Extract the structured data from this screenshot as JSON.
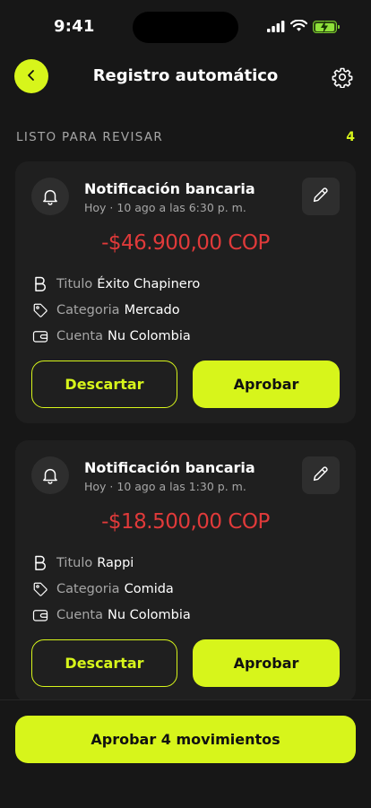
{
  "status_bar": {
    "time": "9:41"
  },
  "header": {
    "title": "Registro automático"
  },
  "section": {
    "label": "LISTO PARA REVISAR",
    "count": "4"
  },
  "labels": {
    "titulo": "Titulo",
    "categoria": "Categoria",
    "cuenta": "Cuenta"
  },
  "actions": {
    "discard": "Descartar",
    "approve": "Aprobar"
  },
  "cards": [
    {
      "title": "Notificación bancaria",
      "subtitle": "Hoy · 10 ago a las 6:30 p. m.",
      "amount": "-$46.900,00 COP",
      "titulo": "Éxito Chapinero",
      "categoria": "Mercado",
      "cuenta": "Nu Colombia"
    },
    {
      "title": "Notificación bancaria",
      "subtitle": "Hoy · 10 ago a las 1:30 p. m.",
      "amount": "-$18.500,00 COP",
      "titulo": "Rappi",
      "categoria": "Comida",
      "cuenta": "Nu Colombia"
    }
  ],
  "bottom": {
    "approve_all": "Aprobar 4 movimientos"
  },
  "colors": {
    "accent": "#d7f51b",
    "negative": "#e03a3a",
    "background": "#171717",
    "card": "#1f1f1f"
  }
}
